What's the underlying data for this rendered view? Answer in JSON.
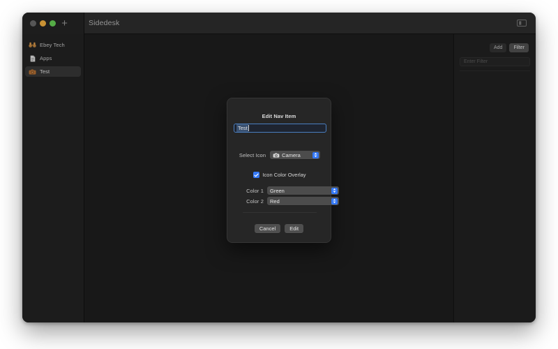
{
  "window": {
    "title": "Sidedesk",
    "traffic_lights": [
      "close",
      "minimize",
      "maximize"
    ],
    "add_tab_glyph": "+",
    "sidebar_toggle_icon": "sidebar-toggle-icon"
  },
  "sidebar": {
    "items": [
      {
        "label": "Ebey Tech",
        "icon": "binoculars-icon",
        "selected": false
      },
      {
        "label": "Apps",
        "icon": "document-icon",
        "selected": false
      },
      {
        "label": "Test",
        "icon": "camera-icon",
        "selected": true
      }
    ]
  },
  "right_panel": {
    "add_label": "Add",
    "filter_label": "Filter",
    "filter_placeholder": "Enter Filter",
    "filter_value": ""
  },
  "dialog": {
    "title": "Edit Nav Item",
    "name_field": {
      "value": "Test",
      "placeholder": "",
      "selected": true
    },
    "select_icon": {
      "label": "Select Icon",
      "value": "Camera",
      "icon": "camera-icon"
    },
    "overlay_checkbox": {
      "label": "Icon Color Overlay",
      "checked": true
    },
    "color1": {
      "label": "Color 1",
      "value": "Green"
    },
    "color2": {
      "label": "Color 2",
      "value": "Red"
    },
    "cancel_label": "Cancel",
    "confirm_label": "Edit"
  },
  "colors": {
    "accent": "#3478f6",
    "window_bg": "#1b1b1b",
    "titlebar_bg": "#2a2a2a",
    "sidebar_bg": "#202020",
    "dialog_bg": "#262626",
    "selection": "#3a5170",
    "traffic_close": "#606060",
    "traffic_min": "#e0a33a",
    "traffic_max": "#5fc04f"
  }
}
